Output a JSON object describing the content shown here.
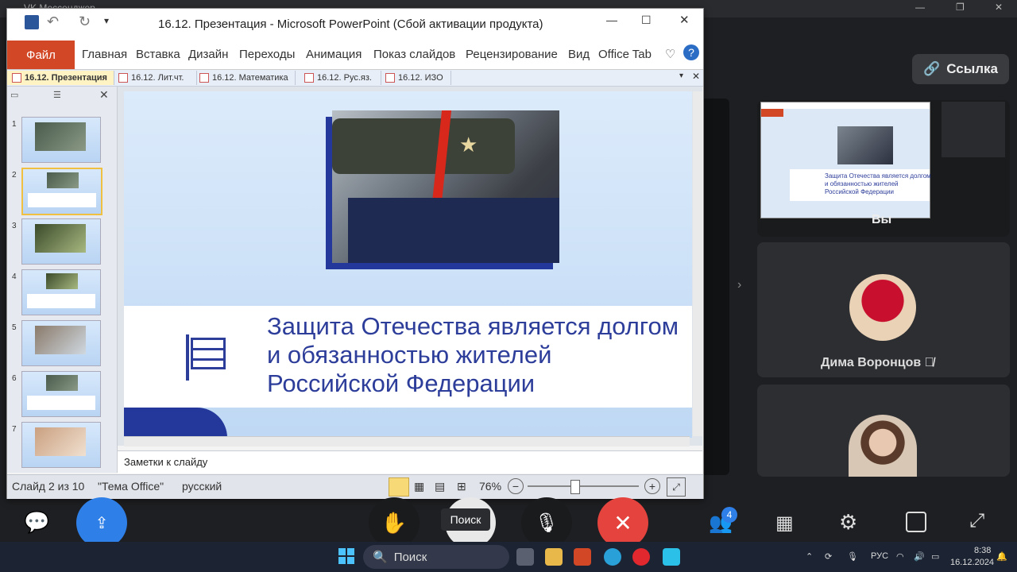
{
  "vk": {
    "title": "VK Мессенджер"
  },
  "link_button": {
    "label": "Ссылка"
  },
  "participants": [
    {
      "name": "Вы"
    },
    {
      "name": "Дима Воронцов"
    },
    {
      "name": ""
    }
  ],
  "participants_badge": "4",
  "tooltip": "Поиск",
  "ppt": {
    "title": "16.12. Презентация  -  Microsoft PowerPoint (Сбой активации продукта)",
    "file_tab": "Файл",
    "ribbon_tabs": [
      "Главная",
      "Вставка",
      "Дизайн",
      "Переходы",
      "Анимация",
      "Показ слайдов",
      "Рецензирование",
      "Вид",
      "Office Tab"
    ],
    "doc_tabs": [
      "16.12. Презентация",
      "16.12. Лит.чт.",
      "16.12. Математика",
      "16.12. Рус.яз.",
      "16.12. ИЗО"
    ],
    "thumb_numbers": [
      "1",
      "2",
      "3",
      "4",
      "5",
      "6",
      "7"
    ],
    "slide_text": [
      "Защита Отечества является долгом",
      "и обязанностью жителей",
      "Российской Федерации"
    ],
    "notes_placeholder": "Заметки к слайду",
    "status": {
      "slide": "Слайд 2 из 10",
      "theme": "\"Тема Office\"",
      "lang": "русский",
      "zoom": "76%",
      "zoom_level": 0.42
    }
  },
  "taskbar": {
    "search": "Поиск",
    "lang": "РУС",
    "time": "8:38",
    "date": "16.12.2024"
  }
}
